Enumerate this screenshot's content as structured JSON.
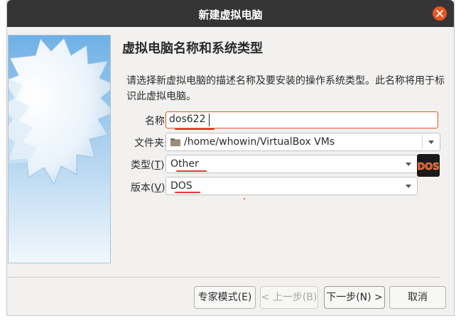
{
  "window": {
    "title": "新建虚拟电脑"
  },
  "page": {
    "heading": "虚拟电脑名称和系统类型",
    "description": "请选择新虚拟电脑的描述名称及要安装的操作系统类型。此名称将用于标识此虚拟电脑。"
  },
  "form": {
    "name_label": "名称:",
    "name_value": "dos622",
    "folder_label": "文件夹:",
    "folder_value": "/home/whowin/VirtualBox VMs",
    "type_label_prefix": "类型(",
    "type_label_key": "T",
    "type_label_suffix": "):",
    "type_value": "Other",
    "version_label_prefix": "版本(",
    "version_label_key": "V",
    "version_label_suffix": "):",
    "version_value": "DOS",
    "os_icon_text": "DOS"
  },
  "buttons": {
    "expert": "专家模式(E)",
    "back": "< 上一步(B)",
    "next": "下一步(N) >",
    "cancel": "取消"
  },
  "colors": {
    "titlebar": "#353535",
    "close": "#e95420",
    "input_focus": "#e95420",
    "annotation": "#e33333"
  }
}
